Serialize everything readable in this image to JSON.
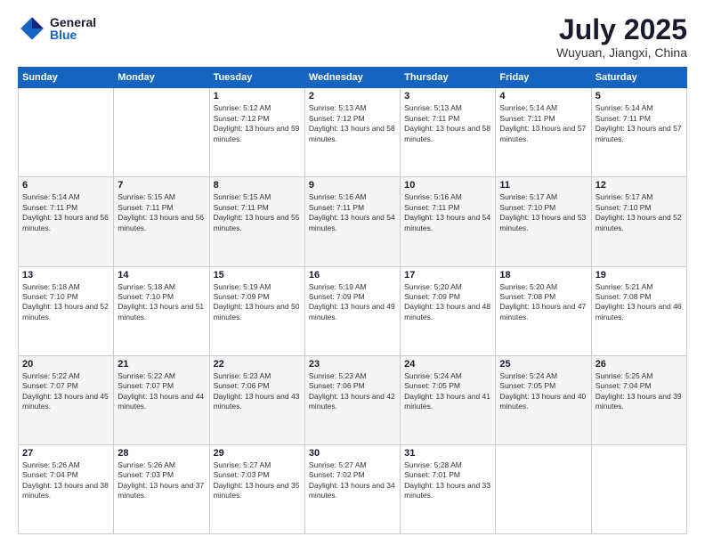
{
  "logo": {
    "general": "General",
    "blue": "Blue"
  },
  "title": "July 2025",
  "subtitle": "Wuyuan, Jiangxi, China",
  "headers": [
    "Sunday",
    "Monday",
    "Tuesday",
    "Wednesday",
    "Thursday",
    "Friday",
    "Saturday"
  ],
  "weeks": [
    [
      {
        "day": "",
        "info": ""
      },
      {
        "day": "",
        "info": ""
      },
      {
        "day": "1",
        "info": "Sunrise: 5:12 AM\nSunset: 7:12 PM\nDaylight: 13 hours and 59 minutes."
      },
      {
        "day": "2",
        "info": "Sunrise: 5:13 AM\nSunset: 7:12 PM\nDaylight: 13 hours and 58 minutes."
      },
      {
        "day": "3",
        "info": "Sunrise: 5:13 AM\nSunset: 7:11 PM\nDaylight: 13 hours and 58 minutes."
      },
      {
        "day": "4",
        "info": "Sunrise: 5:14 AM\nSunset: 7:11 PM\nDaylight: 13 hours and 57 minutes."
      },
      {
        "day": "5",
        "info": "Sunrise: 5:14 AM\nSunset: 7:11 PM\nDaylight: 13 hours and 57 minutes."
      }
    ],
    [
      {
        "day": "6",
        "info": "Sunrise: 5:14 AM\nSunset: 7:11 PM\nDaylight: 13 hours and 56 minutes."
      },
      {
        "day": "7",
        "info": "Sunrise: 5:15 AM\nSunset: 7:11 PM\nDaylight: 13 hours and 56 minutes."
      },
      {
        "day": "8",
        "info": "Sunrise: 5:15 AM\nSunset: 7:11 PM\nDaylight: 13 hours and 55 minutes."
      },
      {
        "day": "9",
        "info": "Sunrise: 5:16 AM\nSunset: 7:11 PM\nDaylight: 13 hours and 54 minutes."
      },
      {
        "day": "10",
        "info": "Sunrise: 5:16 AM\nSunset: 7:11 PM\nDaylight: 13 hours and 54 minutes."
      },
      {
        "day": "11",
        "info": "Sunrise: 5:17 AM\nSunset: 7:10 PM\nDaylight: 13 hours and 53 minutes."
      },
      {
        "day": "12",
        "info": "Sunrise: 5:17 AM\nSunset: 7:10 PM\nDaylight: 13 hours and 52 minutes."
      }
    ],
    [
      {
        "day": "13",
        "info": "Sunrise: 5:18 AM\nSunset: 7:10 PM\nDaylight: 13 hours and 52 minutes."
      },
      {
        "day": "14",
        "info": "Sunrise: 5:18 AM\nSunset: 7:10 PM\nDaylight: 13 hours and 51 minutes."
      },
      {
        "day": "15",
        "info": "Sunrise: 5:19 AM\nSunset: 7:09 PM\nDaylight: 13 hours and 50 minutes."
      },
      {
        "day": "16",
        "info": "Sunrise: 5:19 AM\nSunset: 7:09 PM\nDaylight: 13 hours and 49 minutes."
      },
      {
        "day": "17",
        "info": "Sunrise: 5:20 AM\nSunset: 7:09 PM\nDaylight: 13 hours and 48 minutes."
      },
      {
        "day": "18",
        "info": "Sunrise: 5:20 AM\nSunset: 7:08 PM\nDaylight: 13 hours and 47 minutes."
      },
      {
        "day": "19",
        "info": "Sunrise: 5:21 AM\nSunset: 7:08 PM\nDaylight: 13 hours and 46 minutes."
      }
    ],
    [
      {
        "day": "20",
        "info": "Sunrise: 5:22 AM\nSunset: 7:07 PM\nDaylight: 13 hours and 45 minutes."
      },
      {
        "day": "21",
        "info": "Sunrise: 5:22 AM\nSunset: 7:07 PM\nDaylight: 13 hours and 44 minutes."
      },
      {
        "day": "22",
        "info": "Sunrise: 5:23 AM\nSunset: 7:06 PM\nDaylight: 13 hours and 43 minutes."
      },
      {
        "day": "23",
        "info": "Sunrise: 5:23 AM\nSunset: 7:06 PM\nDaylight: 13 hours and 42 minutes."
      },
      {
        "day": "24",
        "info": "Sunrise: 5:24 AM\nSunset: 7:05 PM\nDaylight: 13 hours and 41 minutes."
      },
      {
        "day": "25",
        "info": "Sunrise: 5:24 AM\nSunset: 7:05 PM\nDaylight: 13 hours and 40 minutes."
      },
      {
        "day": "26",
        "info": "Sunrise: 5:25 AM\nSunset: 7:04 PM\nDaylight: 13 hours and 39 minutes."
      }
    ],
    [
      {
        "day": "27",
        "info": "Sunrise: 5:26 AM\nSunset: 7:04 PM\nDaylight: 13 hours and 38 minutes."
      },
      {
        "day": "28",
        "info": "Sunrise: 5:26 AM\nSunset: 7:03 PM\nDaylight: 13 hours and 37 minutes."
      },
      {
        "day": "29",
        "info": "Sunrise: 5:27 AM\nSunset: 7:03 PM\nDaylight: 13 hours and 35 minutes."
      },
      {
        "day": "30",
        "info": "Sunrise: 5:27 AM\nSunset: 7:02 PM\nDaylight: 13 hours and 34 minutes."
      },
      {
        "day": "31",
        "info": "Sunrise: 5:28 AM\nSunset: 7:01 PM\nDaylight: 13 hours and 33 minutes."
      },
      {
        "day": "",
        "info": ""
      },
      {
        "day": "",
        "info": ""
      }
    ]
  ]
}
